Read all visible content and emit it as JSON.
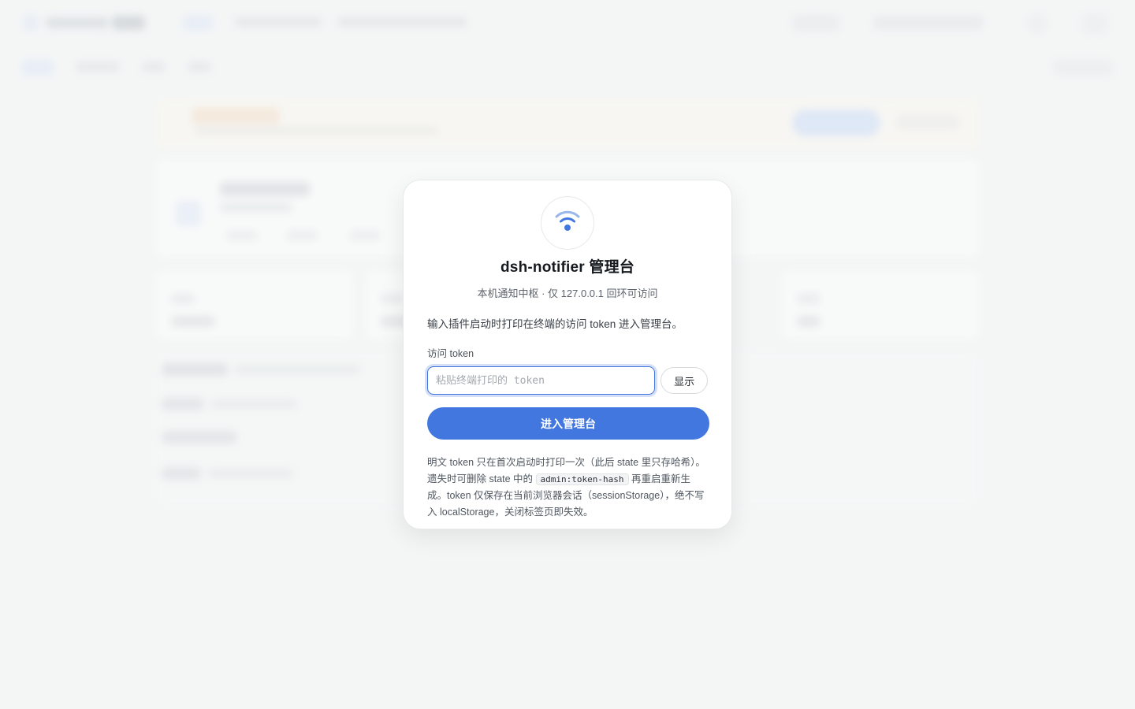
{
  "app": {
    "title": "dsh-notifier 管理台",
    "subtitle": "本机通知中枢 · 仅 127.0.0.1 回环可访问"
  },
  "login": {
    "intro": "输入插件启动时打印在终端的访问 token 进入管理台。",
    "token_label": "访问 token",
    "token_placeholder": "粘贴终端打印的 token",
    "token_value": "",
    "show_label": "显示",
    "submit_label": "进入管理台",
    "note_part1": "明文 token 只在首次启动时打印一次（此后 state 里只存哈希）。遗失时可删除 state 中的 ",
    "note_code": "admin:token-hash",
    "note_part2": " 再重启重新生成。token 仅保存在当前浏览器会话（sessionStorage），绝不写入 localStorage，关闭标签页即失效。"
  },
  "icons": {
    "logo": "wifi-signal-icon"
  },
  "colors": {
    "accent": "#4277df",
    "background": "#f4f6f6",
    "card": "#ffffff"
  }
}
